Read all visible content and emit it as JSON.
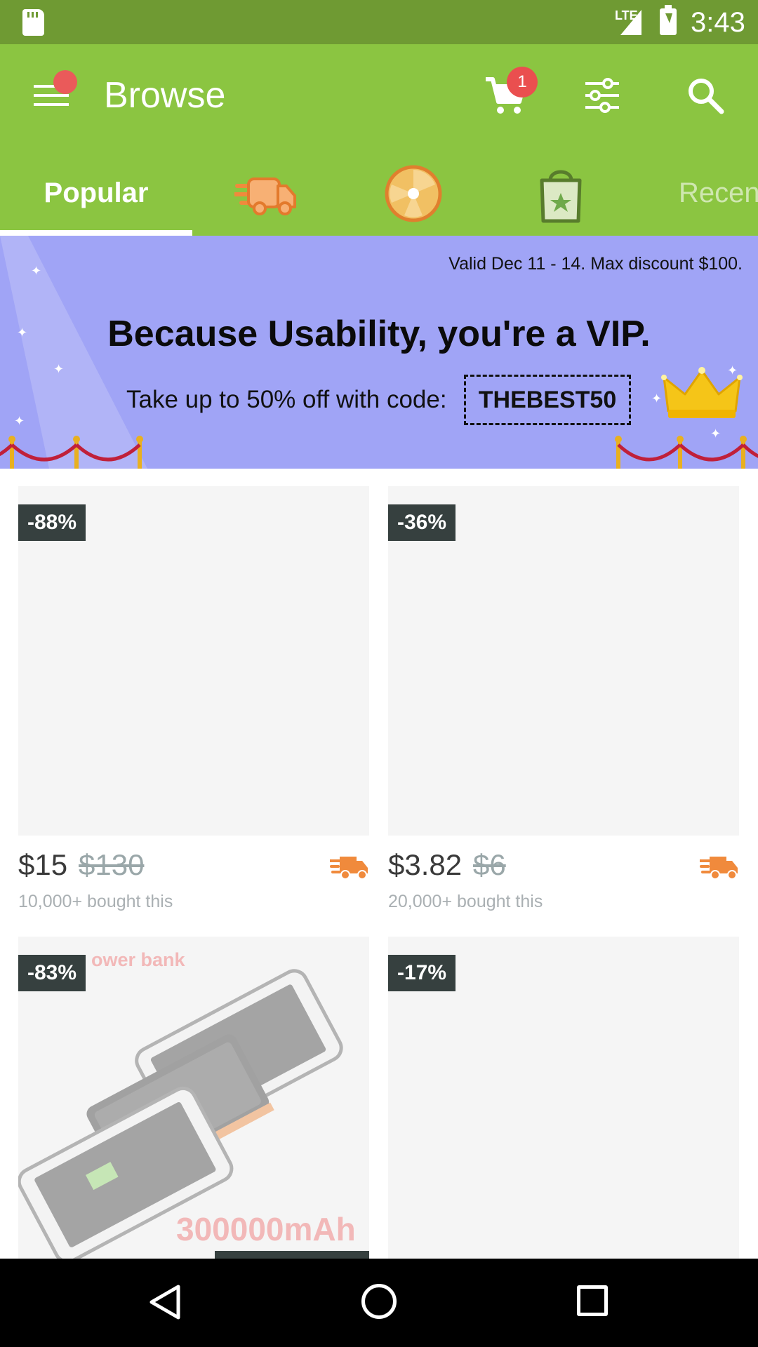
{
  "status_bar": {
    "network": "LTE",
    "time": "3:43"
  },
  "app_bar": {
    "title": "Browse",
    "cart_count": "1"
  },
  "tabs": {
    "popular": "Popular",
    "recent": "Recen",
    "icons": [
      "fast-shipping-icon",
      "prize-wheel-icon",
      "shopping-bag-icon"
    ]
  },
  "banner": {
    "valid_text": "Valid Dec 11 - 14. Max discount $100.",
    "headline": "Because Usability, you're a VIP.",
    "offer_text": "Take up to 50% off with code:",
    "code": "THEBEST50"
  },
  "products": [
    {
      "discount": "-88%",
      "price": "$15",
      "old_price": "$130",
      "bought": "10,000+ bought this"
    },
    {
      "discount": "-36%",
      "price": "$3.82",
      "old_price": "$6",
      "bought": "20,000+ bought this"
    },
    {
      "discount": "-83%",
      "image_text_top": "ower bank",
      "image_text_bottom": "300000mAh"
    },
    {
      "discount": "-17%"
    }
  ],
  "colors": {
    "status_bar": "#6f9a33",
    "app_bar": "#8bc541",
    "banner": "#a0a4f6",
    "badge": "#ea4f4f",
    "discount_tag": "#36403f",
    "shipping_icon": "#f08a3c"
  }
}
